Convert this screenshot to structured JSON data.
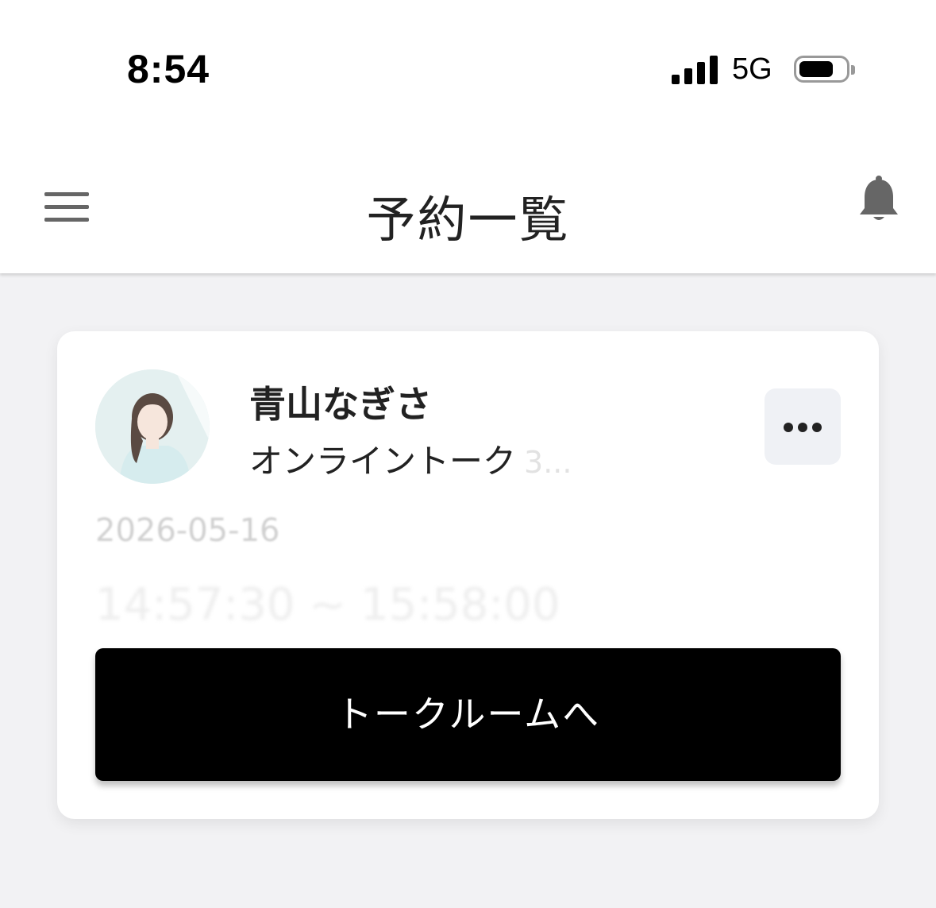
{
  "status_bar": {
    "time": "8:54",
    "network": "5G",
    "battery_level": 0.75
  },
  "header": {
    "title": "予約一覧",
    "menu_icon": "hamburger-icon",
    "bell_icon": "bell-icon"
  },
  "reservation": {
    "name": "青山なぎさ",
    "service": "オンライントーク",
    "service_suffix": "3...",
    "date": "2026-05-16",
    "time_range": "14:57:30 ~ 15:58:00",
    "more_icon": "more-horizontal-icon",
    "talkroom_button": "トークルームへ"
  },
  "colors": {
    "button_bg": "#000000",
    "page_bg": "#f2f2f4",
    "card_bg": "#ffffff",
    "more_bg": "#eff1f5"
  }
}
